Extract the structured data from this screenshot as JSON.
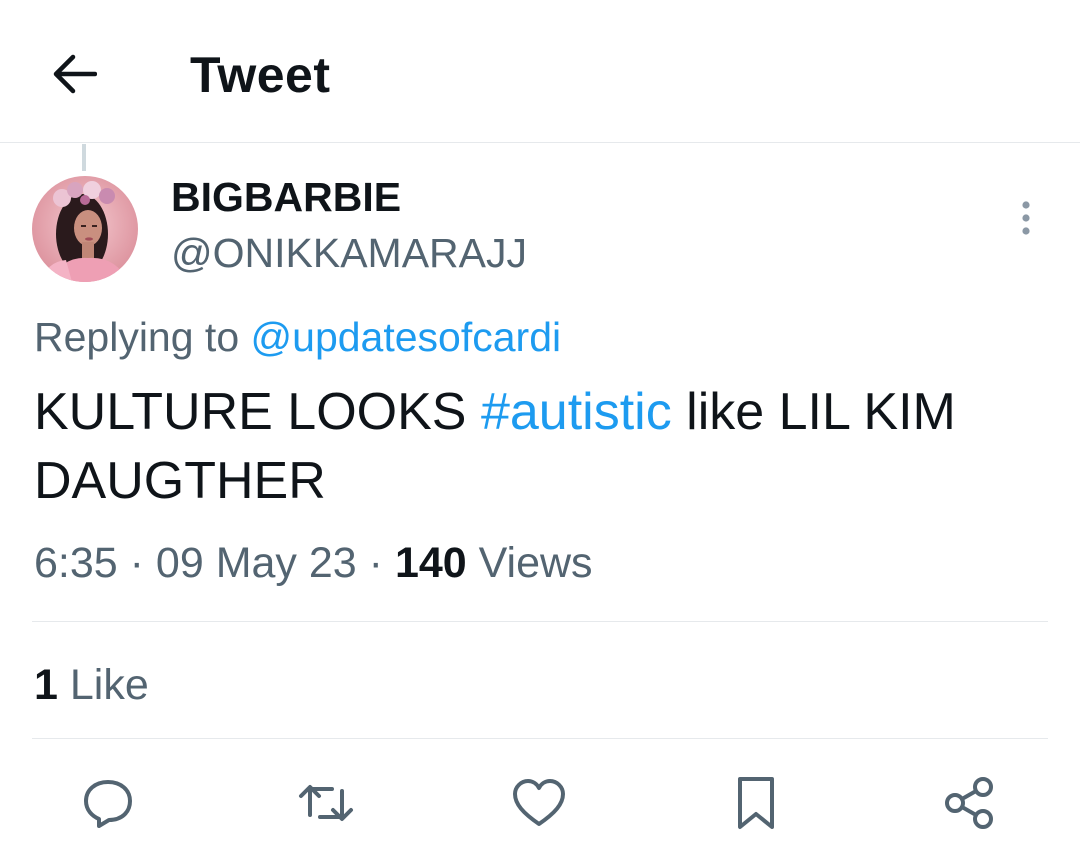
{
  "header": {
    "title": "Tweet",
    "back_icon": "arrow-left-icon"
  },
  "tweet": {
    "author": {
      "display_name": "BIGBARBIE",
      "handle": "@ONIKKAMARAJJ"
    },
    "replying_prefix": "Replying to",
    "replying_to": "@updatesofcardi",
    "text_part1": "KULTURE LOOKS ",
    "hashtag": "#autistic",
    "text_part2": " like LIL KIM DAUGTHER",
    "time": "6:35",
    "separator1": " · ",
    "date": "09 May 23",
    "separator2": " · ",
    "views_count": "140",
    "views_label": " Views",
    "likes_count": "1",
    "likes_label": " Like"
  },
  "actions": [
    {
      "name": "reply",
      "icon": "reply-icon"
    },
    {
      "name": "retweet",
      "icon": "retweet-icon"
    },
    {
      "name": "like",
      "icon": "heart-icon"
    },
    {
      "name": "bookmark",
      "icon": "bookmark-icon"
    },
    {
      "name": "share",
      "icon": "share-icon"
    }
  ],
  "colors": {
    "accent": "#1d9bf0",
    "text_primary": "#0f1419",
    "text_secondary": "#536471",
    "divider": "#e6e9ec"
  }
}
